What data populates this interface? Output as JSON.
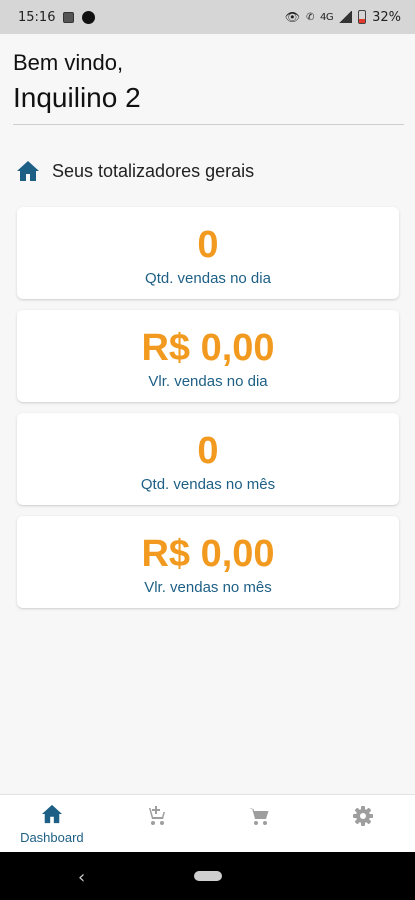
{
  "status_bar": {
    "time": "15:16",
    "signal_text": "4G",
    "battery": "32%",
    "icons": [
      "image-icon",
      "notification-dot-icon",
      "eye-icon",
      "call-icon",
      "signal-icon",
      "battery-icon"
    ]
  },
  "header": {
    "welcome": "Bem vindo,",
    "user_name": "Inquilino 2"
  },
  "section": {
    "title": "Seus totalizadores gerais",
    "icon": "home-icon"
  },
  "cards": [
    {
      "value": "0",
      "label": "Qtd. vendas no dia"
    },
    {
      "value": "R$ 0,00",
      "label": "Vlr. vendas no dia"
    },
    {
      "value": "0",
      "label": "Qtd. vendas no mês"
    },
    {
      "value": "R$ 0,00",
      "label": "Vlr. vendas no mês"
    }
  ],
  "bottom_nav": {
    "items": [
      {
        "label": "Dashboard",
        "icon": "home-icon",
        "active": true
      },
      {
        "label": "",
        "icon": "add-cart-icon",
        "active": false
      },
      {
        "label": "",
        "icon": "cart-icon",
        "active": false
      },
      {
        "label": "",
        "icon": "settings-icon",
        "active": false
      }
    ]
  },
  "colors": {
    "accent_orange": "#f29a1f",
    "primary_blue": "#1d5f85",
    "inactive_icon": "#9e9e9e"
  }
}
